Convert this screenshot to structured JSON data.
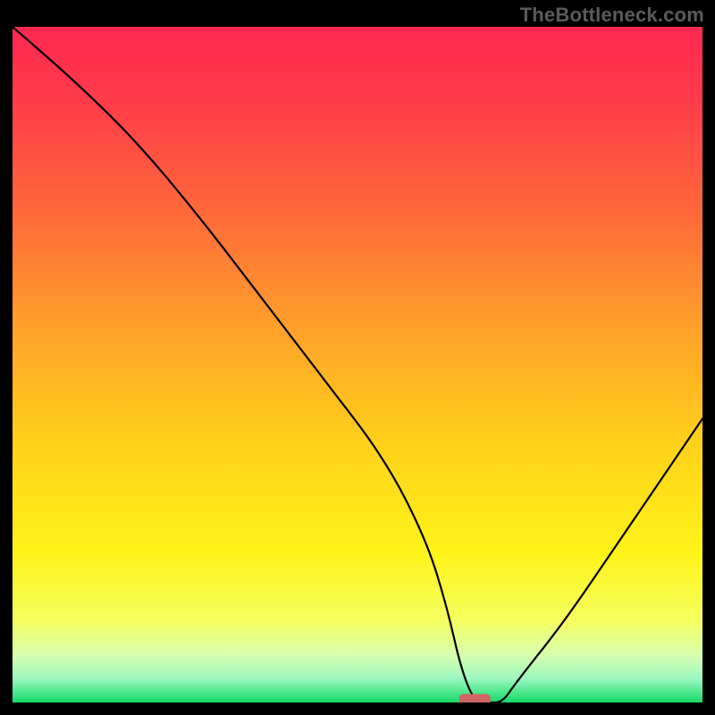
{
  "watermark": "TheBottleneck.com",
  "chart_data": {
    "type": "line",
    "title": "",
    "xlabel": "",
    "ylabel": "",
    "xlim": [
      0,
      100
    ],
    "ylim": [
      0,
      100
    ],
    "grid": false,
    "legend": false,
    "marker": {
      "x": 67,
      "y": 0,
      "shape": "rounded-rect",
      "color": "#cf6565"
    },
    "series": [
      {
        "name": "bottleneck-curve",
        "color": "#000000",
        "x": [
          0,
          9,
          18,
          27,
          36,
          45,
          54,
          60,
          63,
          65,
          67,
          69,
          71,
          73,
          80,
          88,
          96,
          100
        ],
        "values": [
          100,
          92,
          83,
          72,
          60,
          48,
          36,
          24,
          14,
          5,
          0,
          0,
          0,
          3,
          12,
          24,
          36,
          42
        ]
      }
    ],
    "gradient_stops": [
      {
        "offset": 0.0,
        "color": "#ff2850"
      },
      {
        "offset": 0.1,
        "color": "#ff3a4a"
      },
      {
        "offset": 0.28,
        "color": "#ff6a3a"
      },
      {
        "offset": 0.45,
        "color": "#ffa22a"
      },
      {
        "offset": 0.62,
        "color": "#ffd21a"
      },
      {
        "offset": 0.78,
        "color": "#fff31a"
      },
      {
        "offset": 0.88,
        "color": "#f4ff60"
      },
      {
        "offset": 0.93,
        "color": "#d8ffb0"
      },
      {
        "offset": 0.965,
        "color": "#9bf7c0"
      },
      {
        "offset": 0.985,
        "color": "#4be88e"
      },
      {
        "offset": 1.0,
        "color": "#18d868"
      }
    ]
  }
}
